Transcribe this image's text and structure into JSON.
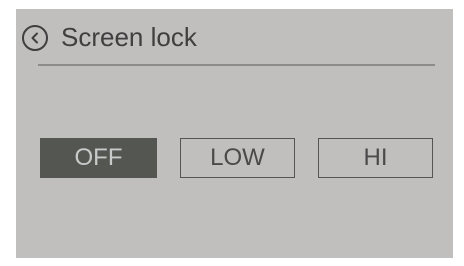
{
  "header": {
    "back_icon": "chevron-left-circle-icon",
    "title": "Screen lock"
  },
  "options": [
    {
      "label": "OFF",
      "selected": true
    },
    {
      "label": "LOW",
      "selected": false
    },
    {
      "label": "HI",
      "selected": false
    }
  ],
  "colors": {
    "background": "#c1bebe",
    "text": "#3f3f3f",
    "selected_fill": "#545652",
    "selected_text": "#c9c9c9",
    "divider": "#8e8b8b"
  }
}
